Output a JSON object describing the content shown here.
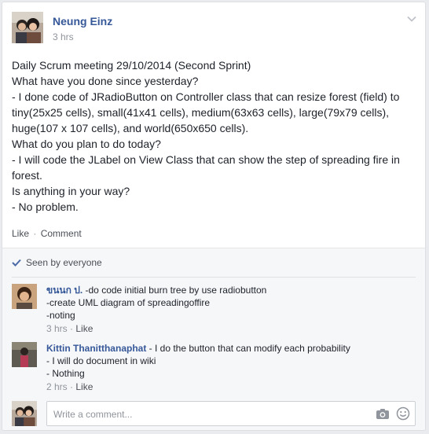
{
  "post": {
    "author": "Neung Einz",
    "timestamp": "3 hrs",
    "avatar_icon": "couple-photo-avatar",
    "menu_icon": "chevron-down-icon",
    "body_lines": [
      "Daily Scrum meeting 29/10/2014 (Second Sprint)",
      "What have you done since yesterday?",
      "- I done code of JRadioButton on Controller class that can resize forest (field) to tiny(25x25 cells), small(41x41 cells), medium(63x63 cells), large(79x79 cells), huge(107 x 107 cells), and world(650x650 cells).",
      "What do you plan to do today?",
      "- I will code the JLabel on View Class that can show the step of spreading fire in forest.",
      "Is anything in your way?",
      "- No problem."
    ],
    "actions": {
      "like": "Like",
      "separator": "·",
      "comment": "Comment"
    }
  },
  "feedback": {
    "seen_text": "Seen by everyone",
    "seen_icon": "checkmark-icon",
    "comments": [
      {
        "author": "ขนนก ป.",
        "lines": [
          "-do code initial burn tree by use radiobutton",
          "-create UML diagram of spreadingoffire",
          "-noting"
        ],
        "time": "3 hrs",
        "like": "Like"
      },
      {
        "author": "Kittin Thanitthanaphat",
        "lines": [
          "I do the button that can modify each probability",
          "- I will do document in wiki",
          "- Nothing"
        ],
        "time": "2 hrs",
        "like": "Like"
      }
    ],
    "composer": {
      "placeholder": "Write a comment...",
      "camera_icon": "camera-icon",
      "emoji_icon": "smiley-icon"
    }
  },
  "colors": {
    "link": "#365899",
    "meta": "#90949c",
    "feedback_bg": "#f6f7f9",
    "page_bg": "#e9ebee"
  }
}
